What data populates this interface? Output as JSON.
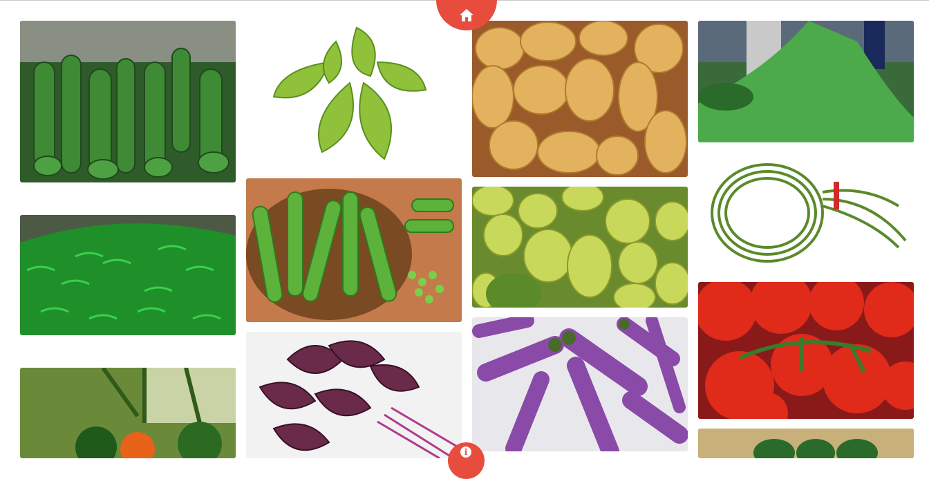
{
  "nav": {
    "home_icon": "home-icon",
    "info_icon": "info-icon",
    "info_glyph": "i",
    "accent_color": "#e84c3d"
  },
  "gallery": {
    "columns": [
      {
        "tiles": [
          {
            "subject": "bottle-gourds",
            "icon": "gourd-icon"
          },
          {
            "subject": "green-chilies",
            "icon": "chili-icon"
          },
          {
            "subject": "habanero-peppers",
            "icon": "pepper-icon"
          }
        ]
      },
      {
        "tiles": [
          {
            "subject": "malabar-spinach",
            "icon": "leaf-icon"
          },
          {
            "subject": "green-peas",
            "icon": "peas-icon"
          },
          {
            "subject": "red-amaranth",
            "icon": "leaf-icon"
          }
        ]
      },
      {
        "tiles": [
          {
            "subject": "potatoes",
            "icon": "potato-icon"
          },
          {
            "subject": "spiny-gourds",
            "icon": "gourd-icon"
          },
          {
            "subject": "eggplants",
            "icon": "eggplant-icon"
          }
        ]
      },
      {
        "tiles": [
          {
            "subject": "leafy-greens-market",
            "icon": "leaf-icon"
          },
          {
            "subject": "long-beans",
            "icon": "beans-icon"
          },
          {
            "subject": "tomatoes",
            "icon": "tomato-icon"
          },
          {
            "subject": "cucumbers-basket",
            "icon": "cucumber-icon"
          }
        ]
      }
    ]
  }
}
